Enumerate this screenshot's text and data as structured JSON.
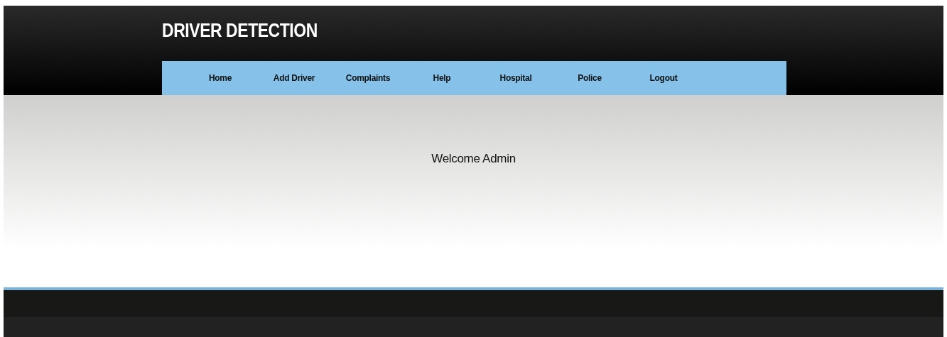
{
  "header": {
    "title": "DRIVER DETECTION"
  },
  "nav": [
    {
      "label": "Home"
    },
    {
      "label": "Add Driver"
    },
    {
      "label": "Complaints"
    },
    {
      "label": "Help"
    },
    {
      "label": "Hospital"
    },
    {
      "label": "Police"
    },
    {
      "label": "Logout"
    }
  ],
  "main": {
    "message": "Welcome Admin"
  }
}
